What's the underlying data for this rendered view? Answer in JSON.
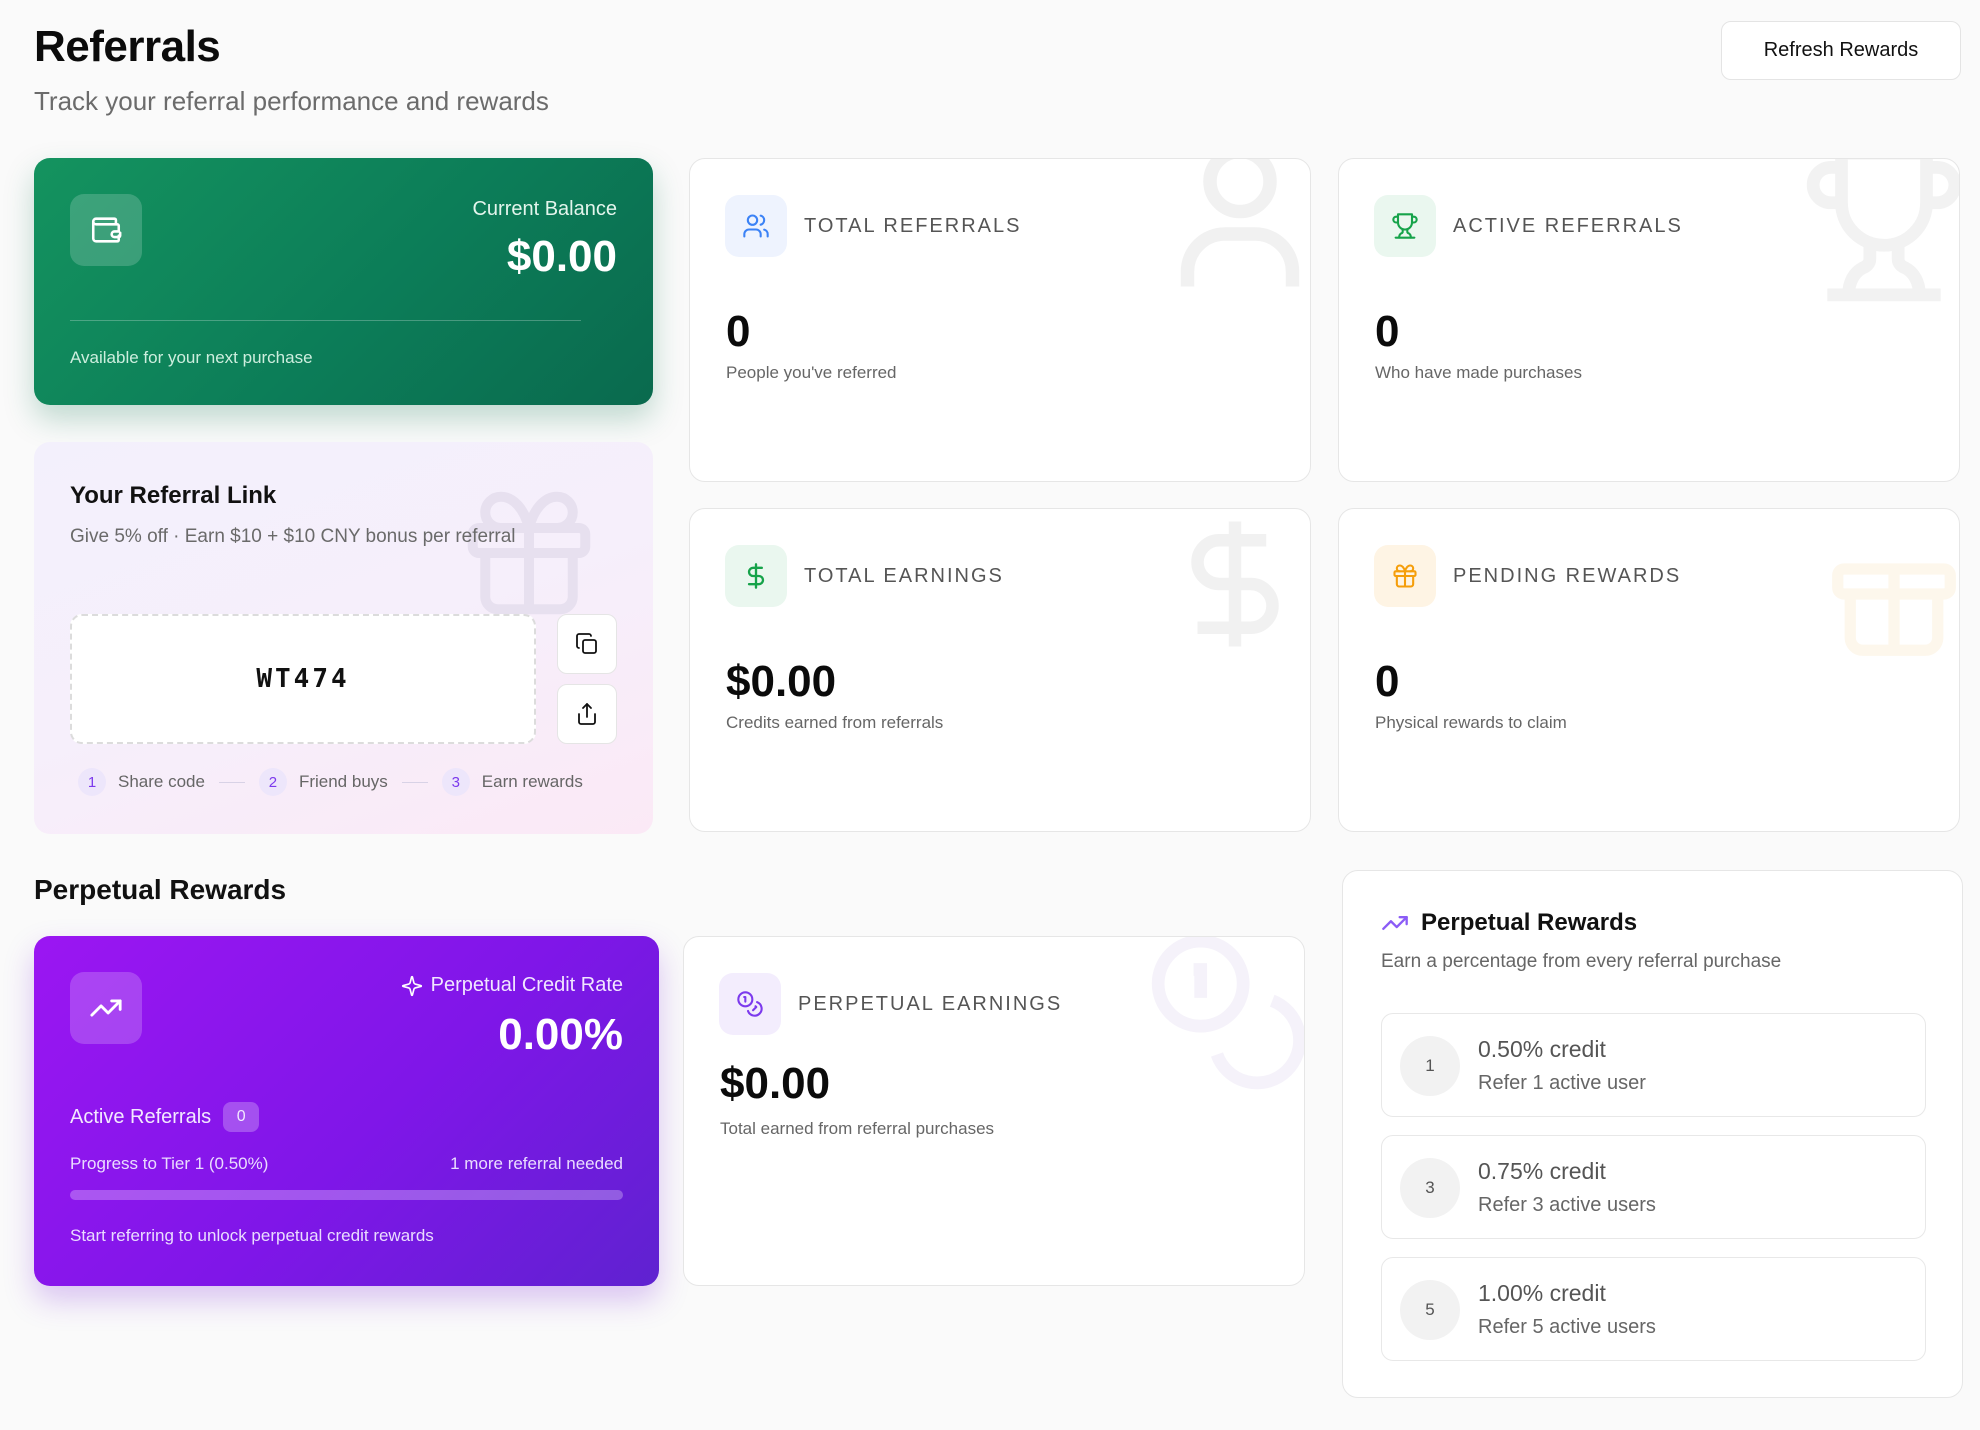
{
  "header": {
    "title": "Referrals",
    "subtitle": "Track your referral performance and rewards",
    "refresh_label": "Refresh Rewards"
  },
  "balance": {
    "label": "Current Balance",
    "value": "$0.00",
    "note": "Available for your next purchase",
    "icon": "wallet-icon"
  },
  "referral_link": {
    "title": "Your Referral Link",
    "subtitle": "Give 5% off · Earn $10 + $10 CNY bonus per referral",
    "code": "WT474",
    "steps": [
      {
        "num": "1",
        "label": "Share code"
      },
      {
        "num": "2",
        "label": "Friend buys"
      },
      {
        "num": "3",
        "label": "Earn rewards"
      }
    ]
  },
  "stats": [
    {
      "label": "TOTAL REFERRALS",
      "value": "0",
      "caption": "People you've referred",
      "icon": "users-icon",
      "accent": "#3b82f6"
    },
    {
      "label": "ACTIVE REFERRALS",
      "value": "0",
      "caption": "Who have made purchases",
      "icon": "trophy-icon",
      "accent": "#16a34a"
    },
    {
      "label": "TOTAL EARNINGS",
      "value": "$0.00",
      "caption": "Credits earned from referrals",
      "icon": "dollar-icon",
      "accent": "#16a34a"
    },
    {
      "label": "PENDING REWARDS",
      "value": "0",
      "caption": "Physical rewards to claim",
      "icon": "gift-icon",
      "accent": "#f59e0b"
    }
  ],
  "perpetual": {
    "section_title": "Perpetual Rewards",
    "rate_label": "Perpetual Credit Rate",
    "rate_value": "0.00%",
    "active_label": "Active Referrals",
    "active_count": "0",
    "progress_label": "Progress to Tier 1 (0.50%)",
    "progress_need": "1 more referral needed",
    "progress_fraction": 0,
    "note": "Start referring to unlock perpetual credit rewards"
  },
  "perpetual_earnings": {
    "label": "PERPETUAL EARNINGS",
    "value": "$0.00",
    "caption": "Total earned from referral purchases",
    "icon": "coins-icon"
  },
  "tiers": {
    "title": "Perpetual Rewards",
    "subtitle": "Earn a percentage from every referral purchase",
    "items": [
      {
        "num": "1",
        "credit": "0.50% credit",
        "requirement": "Refer 1 active user"
      },
      {
        "num": "3",
        "credit": "0.75% credit",
        "requirement": "Refer 3 active users"
      },
      {
        "num": "5",
        "credit": "1.00% credit",
        "requirement": "Refer 5 active users"
      }
    ]
  }
}
